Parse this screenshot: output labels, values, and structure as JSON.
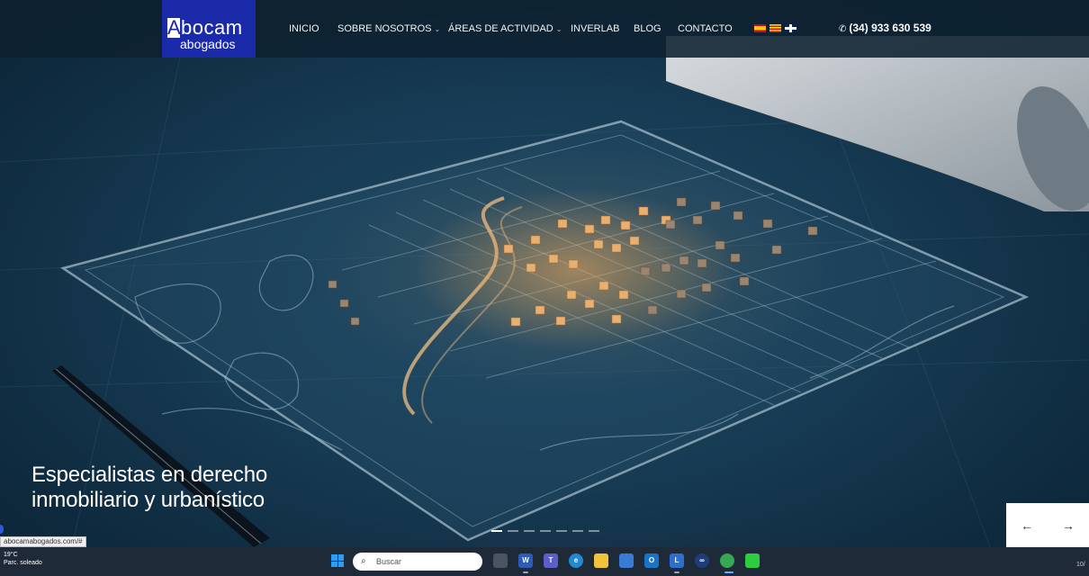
{
  "header": {
    "logo_line1": "bocam",
    "logo_initial": "A",
    "logo_line2": "abogados",
    "nav": [
      {
        "label": "INICIO"
      },
      {
        "label": "SOBRE NOSOTROS",
        "caret": "⌄"
      },
      {
        "label": "ÁREAS DE ACTIVIDAD",
        "caret": "⌄"
      },
      {
        "label": "INVERLAB"
      },
      {
        "label": "BLOG"
      },
      {
        "label": "CONTACTO"
      }
    ],
    "languages": [
      "es-flag-icon",
      "ca-flag-icon",
      "en-flag-icon"
    ],
    "phone": "(34) 933 630 539",
    "phone_icon": "✆"
  },
  "hero": {
    "headline_line1": "Especialistas en derecho",
    "headline_line2": "inmobiliario y urbanístico",
    "slide_count": 7,
    "active_slide": 1,
    "prev_arrow": "←",
    "next_arrow": "→"
  },
  "status_url": "abocamabogados.com/#",
  "taskbar": {
    "weather_temp": "19°C",
    "weather_desc": "Parc. soleado",
    "search_placeholder": "Buscar",
    "clock": "10/"
  },
  "colors": {
    "logo_bg": "#1b2aa8",
    "header_bg": "#0e2130",
    "taskbar_bg": "#1f2a38"
  }
}
